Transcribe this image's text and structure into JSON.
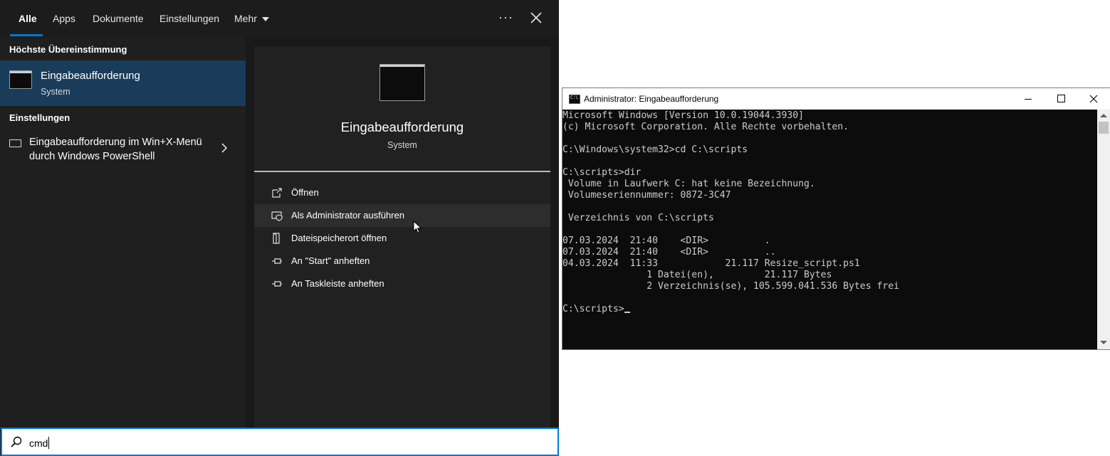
{
  "search_panel": {
    "tabs": [
      {
        "label": "Alle",
        "active": true
      },
      {
        "label": "Apps"
      },
      {
        "label": "Dokumente"
      },
      {
        "label": "Einstellungen"
      },
      {
        "label": "Mehr"
      }
    ],
    "more_options": "···",
    "best_match": {
      "section_label": "Höchste Übereinstimmung",
      "title": "Eingabeaufforderung",
      "subtitle": "System",
      "icon": "command-prompt-icon"
    },
    "settings": {
      "section_label": "Einstellungen",
      "item_label": "Eingabeaufforderung im Win+X-Menü durch Windows PowerShell",
      "icon": "display-settings-icon"
    },
    "preview": {
      "title": "Eingabeaufforderung",
      "subtitle": "System",
      "actions": [
        {
          "label": "Öffnen",
          "icon": "open-icon"
        },
        {
          "label": "Als Administrator ausführen",
          "icon": "run-as-admin-icon",
          "hovered": true
        },
        {
          "label": "Dateispeicherort öffnen",
          "icon": "file-location-icon"
        },
        {
          "label": "An \"Start\" anheften",
          "icon": "pin-start-icon"
        },
        {
          "label": "An Taskleiste anheften",
          "icon": "pin-taskbar-icon"
        }
      ]
    },
    "search_box": {
      "value": "cmd"
    },
    "colors": {
      "accent": "#0078d7",
      "selected": "#193c5a"
    }
  },
  "console": {
    "title": "Administrator: Eingabeaufforderung",
    "lines": [
      "Microsoft Windows [Version 10.0.19044.3930]",
      "(c) Microsoft Corporation. Alle Rechte vorbehalten.",
      "",
      "C:\\Windows\\system32>cd C:\\scripts",
      "",
      "C:\\scripts>dir",
      " Volume in Laufwerk C: hat keine Bezeichnung.",
      " Volumeseriennummer: 0872-3C47",
      "",
      " Verzeichnis von C:\\scripts",
      "",
      "07.03.2024  21:40    <DIR>          .",
      "07.03.2024  21:40    <DIR>          ..",
      "04.03.2024  11:33            21.117 Resize_script.ps1",
      "               1 Datei(en),         21.117 Bytes",
      "               2 Verzeichnis(se), 105.599.041.536 Bytes frei",
      "",
      "C:\\scripts>"
    ]
  }
}
